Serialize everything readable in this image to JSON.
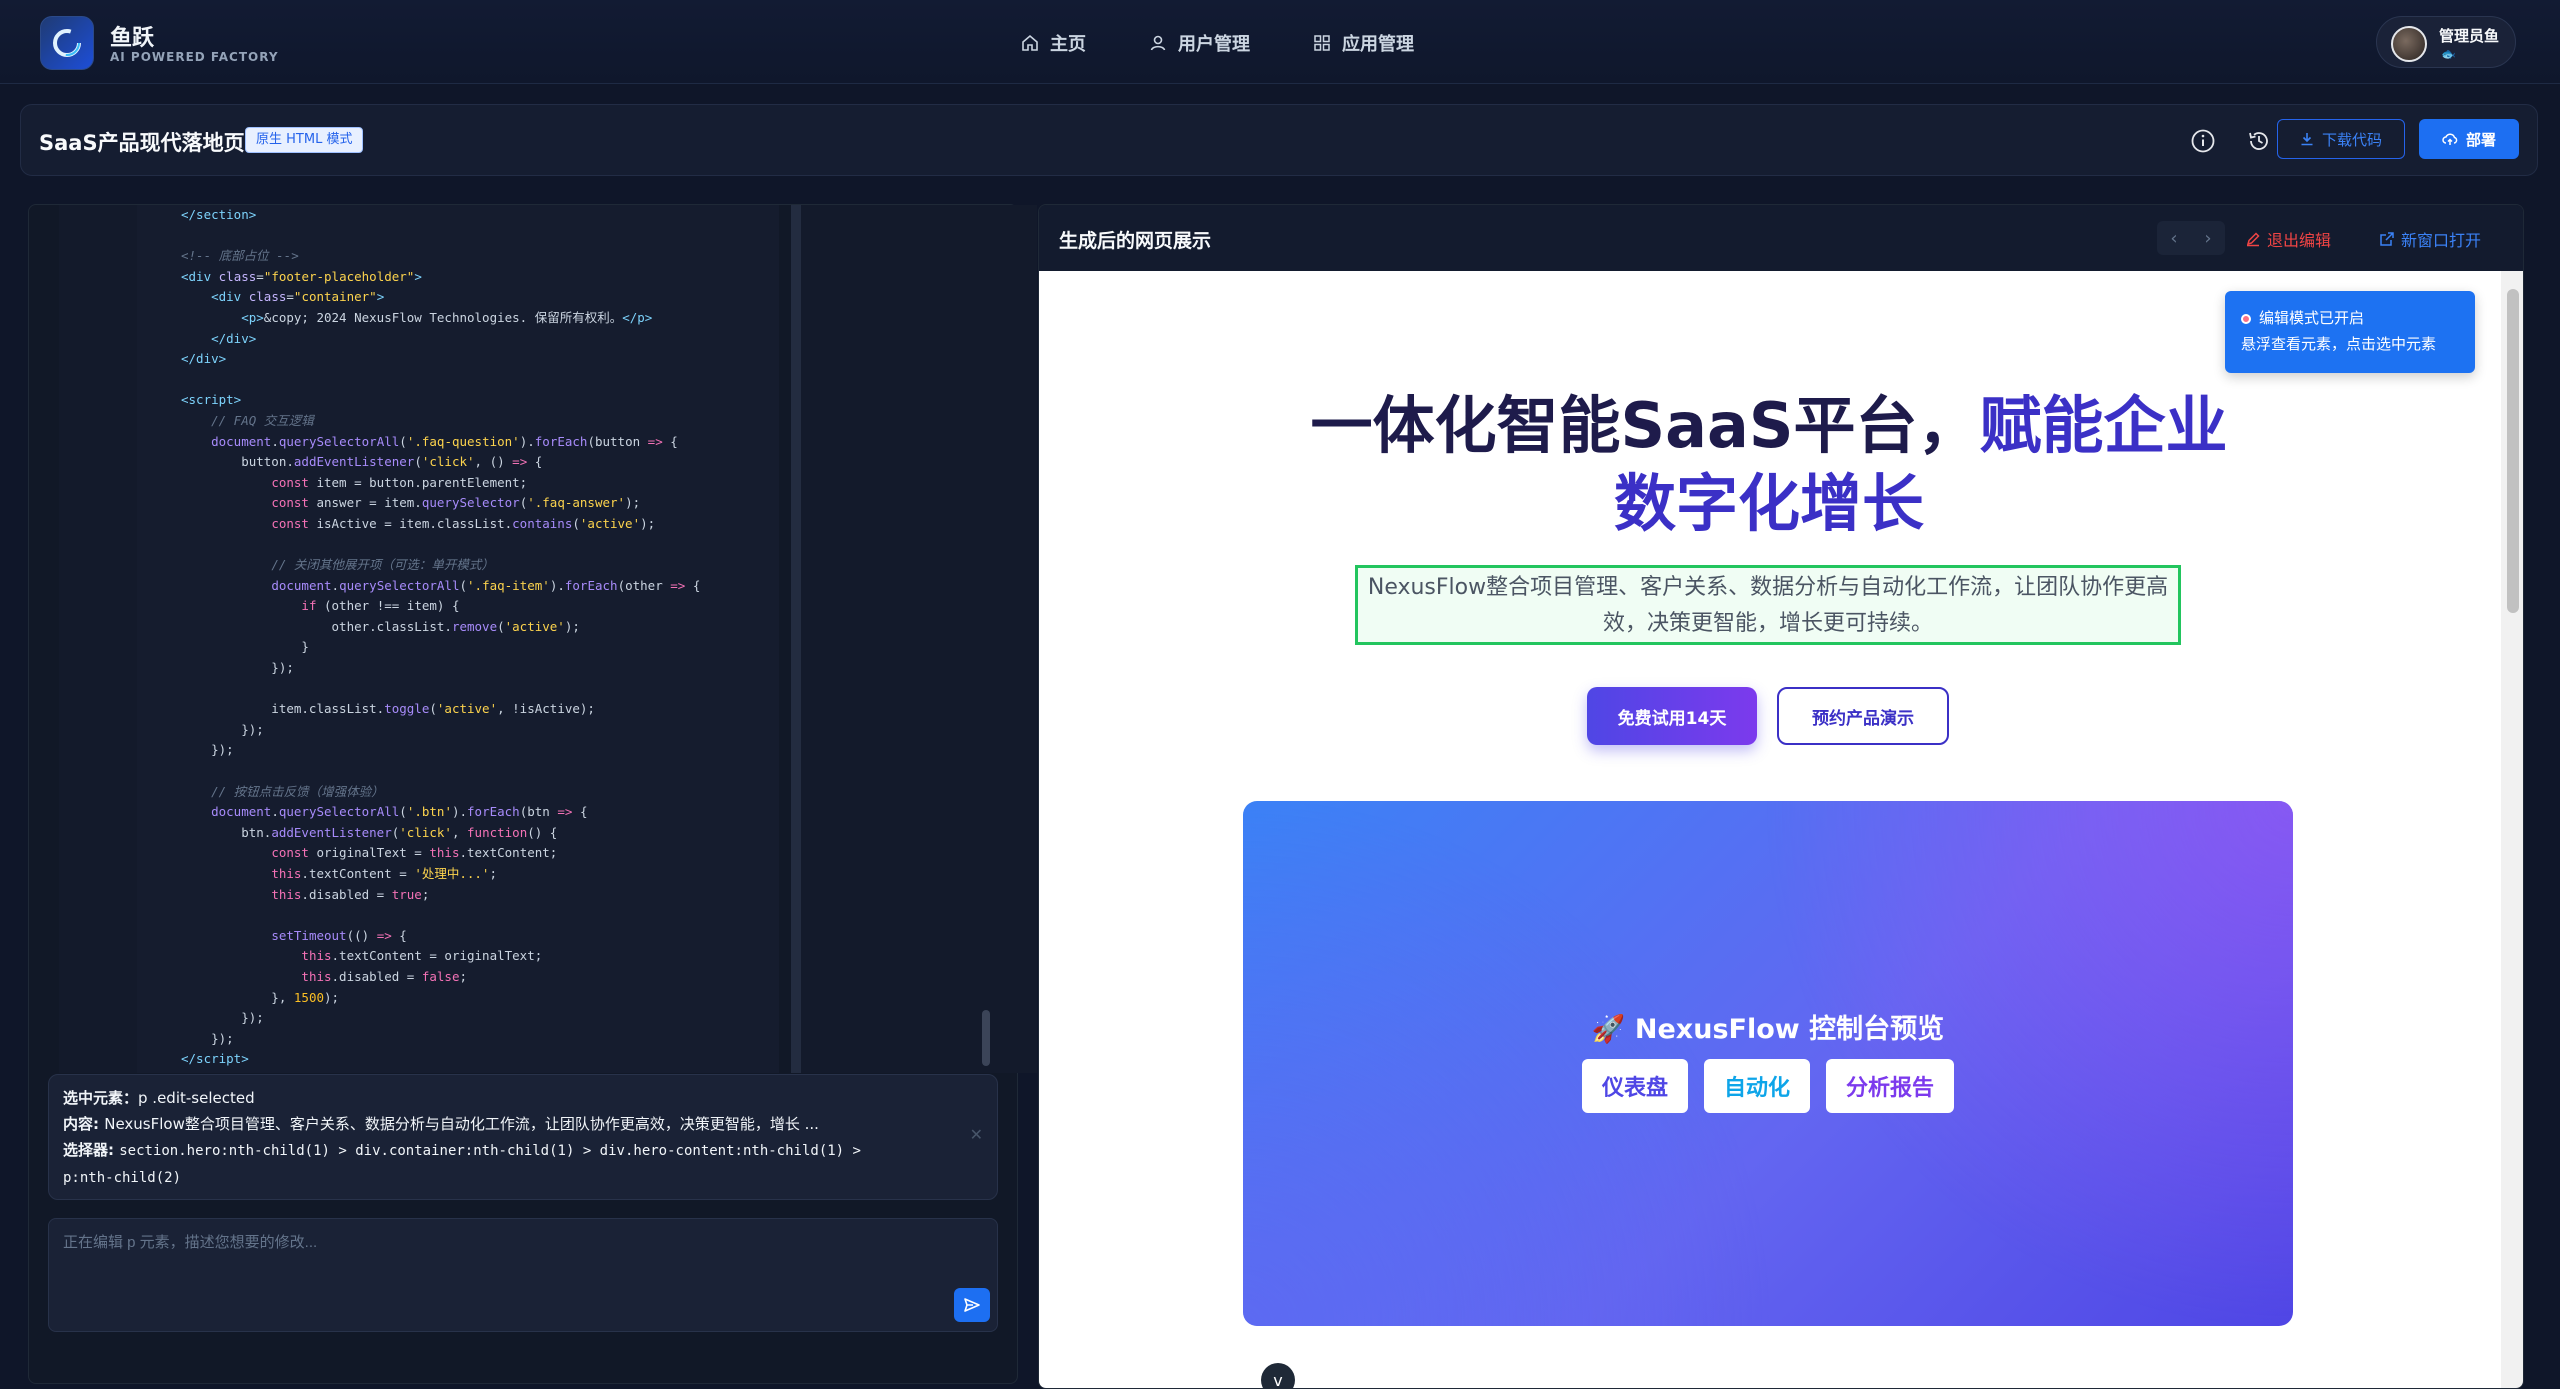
{
  "app": {
    "logo_title": "鱼跃",
    "logo_subtitle": "AI POWERED FACTORY",
    "nav": [
      {
        "label": "主页",
        "icon": "home-icon"
      },
      {
        "label": "用户管理",
        "icon": "user-icon"
      },
      {
        "label": "应用管理",
        "icon": "grid-icon"
      }
    ],
    "user": {
      "name": "管理员鱼",
      "badge": "🐟"
    }
  },
  "project": {
    "title": "SaaS产品现代落地页",
    "mode_badge": "原生 HTML 模式",
    "download_label": "下载代码",
    "deploy_label": "部署"
  },
  "editor": {
    "selection": {
      "element_label": "选中元素：",
      "element_value": "p .edit-selected",
      "content_label": "内容: ",
      "content_value": "NexusFlow整合项目管理、客户关系、数据分析与自动化工作流，让团队协作更高效，决策更智能，增长 ...",
      "selector_label": "选择器: ",
      "selector_value": "section.hero:nth-child(1) > div.container:nth-child(1) > div.hero-content:nth-child(1) >",
      "selector_value_2": "p:nth-child(2)"
    },
    "input_placeholder": "正在编辑 p 元素，描述您想要的修改..."
  },
  "preview": {
    "header_title": "生成后的网页展示",
    "exit_edit_label": "退出编辑",
    "open_new_label": "新窗口打开",
    "toast_line1": "编辑模式已开启",
    "toast_line2": "悬浮查看元素，点击选中元素",
    "hero_title_part1": "一体化智能SaaS平台，",
    "hero_title_accent": "赋能企业",
    "hero_title_part2": "数字化增长",
    "hero_desc": "NexusFlow整合项目管理、客户关系、数据分析与自动化工作流，让团队协作更高效，决策更智能，增长更可持续。",
    "btn_primary": "免费试用14天",
    "btn_secondary": "预约产品演示",
    "dash_title": "🚀 NexusFlow 控制台预览",
    "dash_tabs": [
      "仪表盘",
      "自动化",
      "分析报告"
    ]
  },
  "colors": {
    "accent": "#1d6ff2",
    "hero_accent": "#3b30c6",
    "selection_outline": "#22c55e",
    "danger": "#ef4444"
  }
}
